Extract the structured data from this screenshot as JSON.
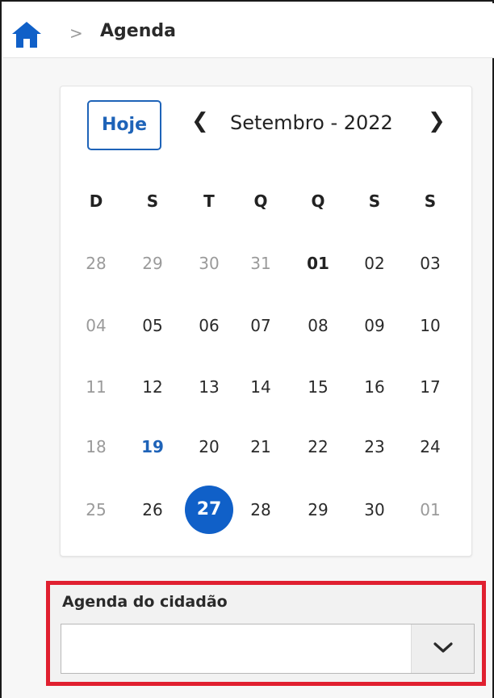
{
  "breadcrumb": {
    "separator": ">",
    "title": "Agenda"
  },
  "calendar": {
    "today_label": "Hoje",
    "prev_icon": "chevron-left-icon",
    "next_icon": "chevron-right-icon",
    "month_label": "Setembro - 2022",
    "weekdays": [
      "D",
      "S",
      "T",
      "Q",
      "Q",
      "S",
      "S"
    ],
    "weeks": [
      [
        "28",
        "29",
        "30",
        "31",
        "01",
        "02",
        "03"
      ],
      [
        "04",
        "05",
        "06",
        "07",
        "08",
        "09",
        "10"
      ],
      [
        "11",
        "12",
        "13",
        "14",
        "15",
        "16",
        "17"
      ],
      [
        "18",
        "19",
        "20",
        "21",
        "22",
        "23",
        "24"
      ],
      [
        "25",
        "26",
        "27",
        "28",
        "29",
        "30",
        "01"
      ]
    ],
    "selected_day": "27",
    "highlighted_day": "19"
  },
  "citizen_agenda": {
    "label": "Agenda do cidadão",
    "value": "",
    "dropdown_icon": "chevron-down-icon"
  },
  "colors": {
    "primary": "#1060c8",
    "highlight_text": "#1e63b8",
    "annotation_outline": "#e02030"
  }
}
